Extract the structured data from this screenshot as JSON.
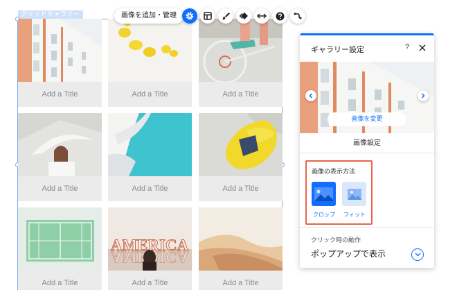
{
  "gallery": {
    "label": "グリッドギャラリー",
    "items": [
      {
        "title": "Add a Title",
        "image": "white-building-balconies"
      },
      {
        "title": "Add a Title",
        "image": "yellow-lemons"
      },
      {
        "title": "Add a Title",
        "image": "bicycle-wheel"
      },
      {
        "title": "Add a Title",
        "image": "woman-with-hat"
      },
      {
        "title": "Add a Title",
        "image": "white-architecture-blue-sky"
      },
      {
        "title": "Add a Title",
        "image": "yellow-armchair"
      },
      {
        "title": "Add a Title",
        "image": "tennis-court"
      },
      {
        "title": "Add a Title",
        "image": "america-sign"
      },
      {
        "title": "Add a Title",
        "image": "desert-dunes"
      }
    ],
    "america_text": "AMERICA"
  },
  "toolbar": {
    "manage_label": "画像を追加・管理",
    "buttons": [
      "gear-icon",
      "layout-icon",
      "brush-icon",
      "animation-icon",
      "stretch-icon",
      "help-icon",
      "connect-icon"
    ]
  },
  "panel": {
    "title": "ギャラリー設定",
    "help": "?",
    "change_image": "画像を変更",
    "image_settings": "画像設定",
    "display_method": "画像の表示方法",
    "options": [
      {
        "label": "クロップ",
        "selected": true
      },
      {
        "label": "フィット",
        "selected": false
      }
    ],
    "click_action_label": "クリック時の動作",
    "click_action_value": "ポップアップで表示"
  },
  "colors": {
    "accent": "#116dff",
    "highlight": "#e8644a",
    "selection": "#7aa6ee"
  }
}
